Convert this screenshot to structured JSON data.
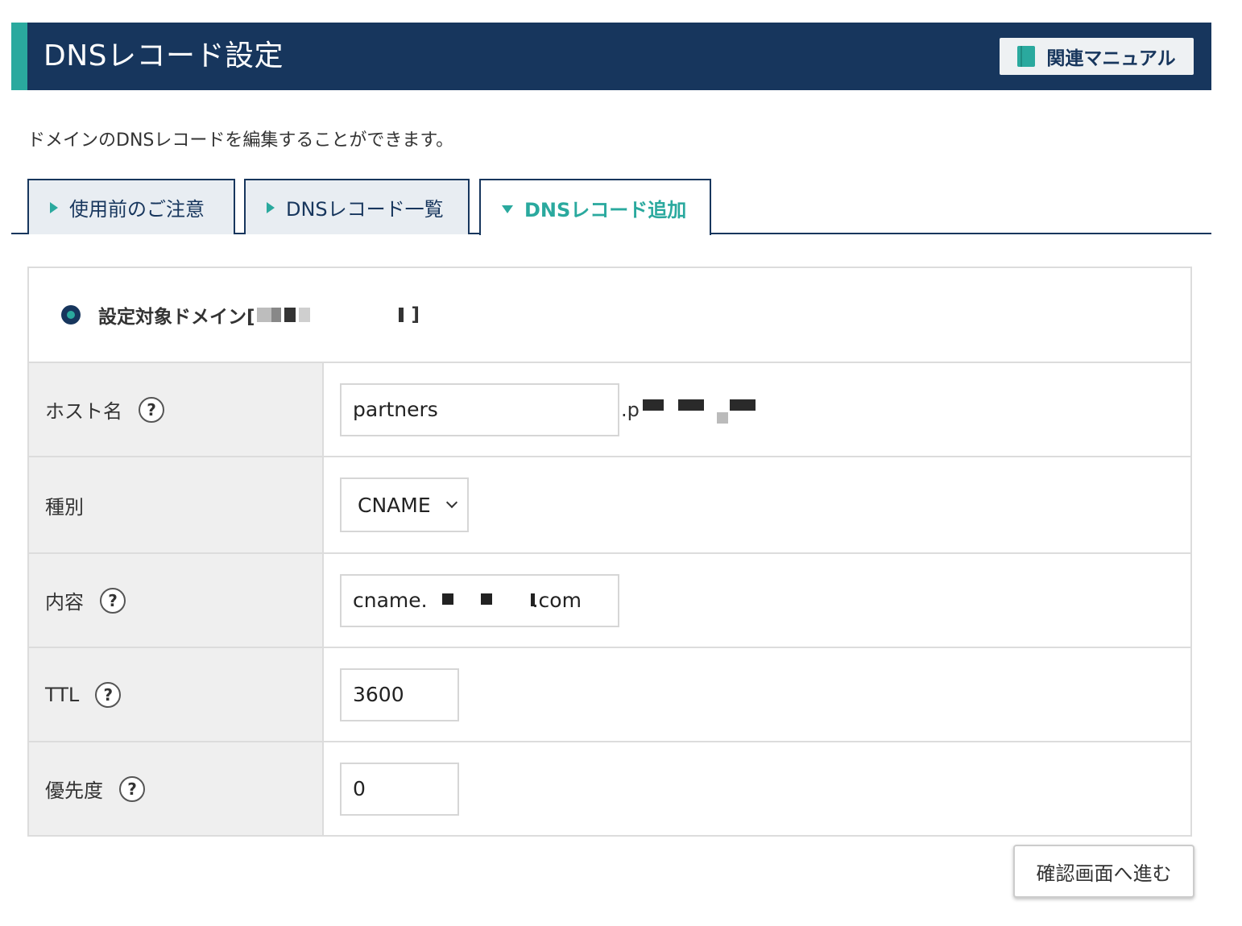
{
  "header": {
    "title": "DNSレコード設定",
    "manual_button": "関連マニュアル"
  },
  "description": "ドメインのDNSレコードを編集することができます。",
  "tabs": [
    {
      "label": "使用前のご注意",
      "active": false
    },
    {
      "label": "DNSレコード一覧",
      "active": false
    },
    {
      "label": "DNSレコード追加",
      "active": true
    }
  ],
  "form": {
    "target_domain_label": "設定対象ドメイン[",
    "target_domain_close": "]",
    "fields": {
      "host": {
        "label": "ホスト名",
        "value": "partners",
        "suffix": ".p"
      },
      "type": {
        "label": "種別",
        "value": "CNAME"
      },
      "content": {
        "label": "内容",
        "value_prefix": "cname.",
        "value_suffix": ".com"
      },
      "ttl": {
        "label": "TTL",
        "value": "3600"
      },
      "priority": {
        "label": "優先度",
        "value": "0"
      }
    },
    "help_glyph": "?"
  },
  "confirm_button": "確認画面へ進む",
  "colors": {
    "header_bg": "#17365d",
    "accent": "#2aa99e",
    "label_bg": "#efefef",
    "border": "#dcdcdc"
  }
}
